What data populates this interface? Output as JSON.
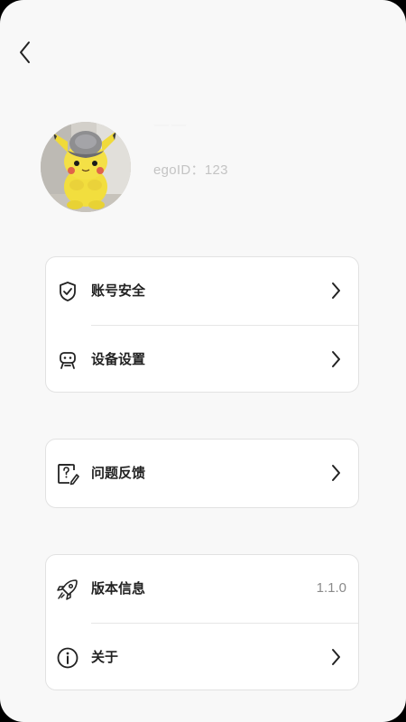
{
  "header": {
    "back_icon": "chevron-left-icon"
  },
  "profile": {
    "username": "——",
    "ego_id": "egoID：123",
    "avatar": "pikachu-plush-photo"
  },
  "groups": [
    {
      "items": [
        {
          "label": "账号安全",
          "icon": "shield-check-icon",
          "trailing": "chevron-right-icon"
        },
        {
          "label": "设备设置",
          "icon": "robot-icon",
          "trailing": "chevron-right-icon"
        }
      ]
    },
    {
      "items": [
        {
          "label": "问题反馈",
          "icon": "feedback-question-icon",
          "trailing": "chevron-right-icon"
        }
      ]
    },
    {
      "items": [
        {
          "label": "版本信息",
          "icon": "rocket-icon",
          "value": "1.1.0"
        },
        {
          "label": "关于",
          "icon": "info-icon",
          "trailing": "chevron-right-icon"
        }
      ]
    }
  ],
  "colors": {
    "background": "#f8f8f8",
    "card": "#ffffff",
    "card_border": "#e2e2e2",
    "text_primary": "#222222",
    "text_secondary": "#8a8a8a",
    "avatar_yellow": "#f2de3e"
  }
}
